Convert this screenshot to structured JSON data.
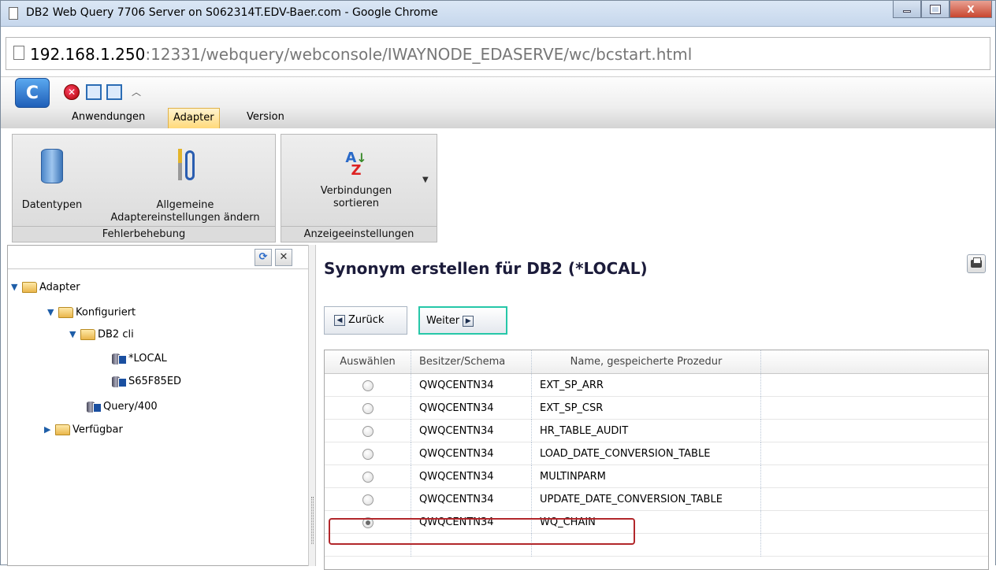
{
  "window": {
    "title": "DB2 Web Query 7706 Server on S062314T.EDV-Baer.com - Google Chrome",
    "url_host": "192.168.1.250",
    "url_path": ":12331/webquery/webconsole/IWAYNODE_EDASERVE/wc/bcstart.html"
  },
  "ribbon": {
    "logo_letter": "C",
    "tabs": [
      "Anwendungen",
      "Adapter",
      "Version"
    ],
    "active_tab": "Adapter",
    "groups": [
      {
        "name": "Fehlerbehebung",
        "buttons": [
          {
            "label": "Datentypen",
            "icon": "database-icon"
          },
          {
            "label_line1": "Allgemeine",
            "label_line2": "Adaptereinstellungen ändern",
            "icon": "tools-icon"
          }
        ]
      },
      {
        "name": "Anzeigeeinstellungen",
        "buttons": [
          {
            "label_line1": "Verbindungen",
            "label_line2": "sortieren",
            "icon": "sort-az-icon"
          }
        ]
      }
    ]
  },
  "tree": {
    "nodes": [
      {
        "label": "Adapter",
        "type": "folder",
        "expanded": true
      },
      {
        "label": "Konfiguriert",
        "type": "folder",
        "expanded": true
      },
      {
        "label": "DB2 cli",
        "type": "folder",
        "expanded": true
      },
      {
        "label": "*LOCAL",
        "type": "connection"
      },
      {
        "label": "S65F85ED",
        "type": "connection"
      },
      {
        "label": "Query/400",
        "type": "connection"
      },
      {
        "label": "Verfügbar",
        "type": "folder",
        "expanded": false
      }
    ]
  },
  "content": {
    "title": "Synonym erstellen für DB2 (*LOCAL)",
    "back_label": "Zurück",
    "next_label": "Weiter",
    "columns": [
      "Auswählen",
      "Besitzer/Schema",
      "Name, gespeicherte Prozedur",
      ""
    ],
    "rows": [
      {
        "selected": false,
        "schema": "QWQCENTN34",
        "name": "EXT_SP_ARR"
      },
      {
        "selected": false,
        "schema": "QWQCENTN34",
        "name": "EXT_SP_CSR"
      },
      {
        "selected": false,
        "schema": "QWQCENTN34",
        "name": "HR_TABLE_AUDIT"
      },
      {
        "selected": false,
        "schema": "QWQCENTN34",
        "name": "LOAD_DATE_CONVERSION_TABLE"
      },
      {
        "selected": false,
        "schema": "QWQCENTN34",
        "name": "MULTINPARM"
      },
      {
        "selected": false,
        "schema": "QWQCENTN34",
        "name": "UPDATE_DATE_CONVERSION_TABLE"
      },
      {
        "selected": true,
        "schema": "QWQCENTN34",
        "name": "WQ_CHAIN"
      }
    ]
  }
}
